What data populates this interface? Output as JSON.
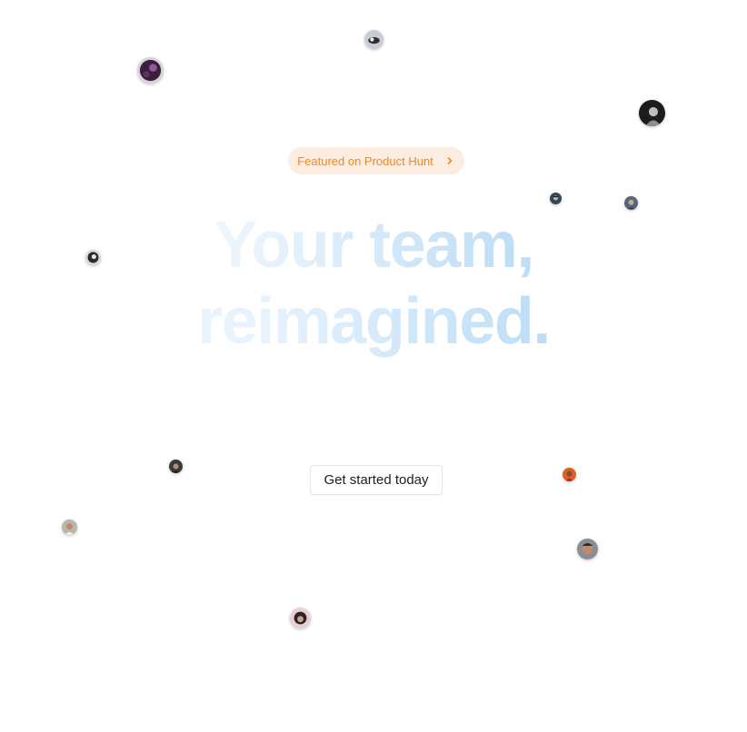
{
  "hero": {
    "badge_label": "Featured on Product Hunt",
    "badge_color": "#f0891f",
    "badge_bg": "#fdece0",
    "headline_line1": "Your team,",
    "headline_line2": "reimagined.",
    "headline_color": "#a3cff0",
    "cta_label": "Get started today"
  },
  "avatars": [
    {
      "name": "avatar-1",
      "colors": [
        "#c9cdd3",
        "#2b2f36"
      ]
    },
    {
      "name": "avatar-2",
      "colors": [
        "#3a1f3d",
        "#8e5a9a"
      ]
    },
    {
      "name": "avatar-3",
      "colors": [
        "#1c1c1c",
        "#bdbdbd"
      ]
    },
    {
      "name": "avatar-4",
      "colors": [
        "#2f4a5e",
        "#d9b39b"
      ]
    },
    {
      "name": "avatar-5",
      "colors": [
        "#52677d",
        "#c9a58e"
      ]
    },
    {
      "name": "avatar-6",
      "colors": [
        "#2a2a2a",
        "#d8d8d8"
      ]
    },
    {
      "name": "avatar-7",
      "colors": [
        "#3a3a3a",
        "#b58b73"
      ]
    },
    {
      "name": "avatar-8",
      "colors": [
        "#d9631e",
        "#b81f2b"
      ]
    },
    {
      "name": "avatar-9",
      "colors": [
        "#b9b5ac",
        "#c98266"
      ]
    },
    {
      "name": "avatar-10",
      "colors": [
        "#8a8d94",
        "#c28a6a"
      ]
    },
    {
      "name": "avatar-11",
      "colors": [
        "#e8cfd2",
        "#2a2223"
      ]
    }
  ]
}
